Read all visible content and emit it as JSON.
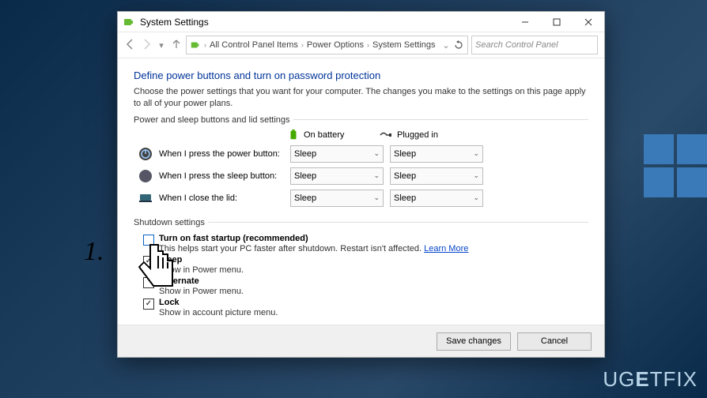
{
  "window": {
    "title": "System Settings",
    "breadcrumbs": [
      "All Control Panel Items",
      "Power Options",
      "System Settings"
    ],
    "search_placeholder": "Search Control Panel"
  },
  "page": {
    "heading": "Define power buttons and turn on password protection",
    "description": "Choose the power settings that you want for your computer. The changes you make to the settings on this page apply to all of your power plans.",
    "section_a": "Power and sleep buttons and lid settings",
    "col_battery": "On battery",
    "col_plugged": "Plugged in",
    "rows": [
      {
        "label": "When I press the power button:",
        "battery": "Sleep",
        "plugged": "Sleep"
      },
      {
        "label": "When I press the sleep button:",
        "battery": "Sleep",
        "plugged": "Sleep"
      },
      {
        "label": "When I close the lid:",
        "battery": "Sleep",
        "plugged": "Sleep"
      }
    ],
    "section_b": "Shutdown settings",
    "shutdown": [
      {
        "checked": false,
        "title": "Turn on fast startup (recommended)",
        "sub": "This helps start your PC faster after shutdown. Restart isn't affected.",
        "learn": "Learn More"
      },
      {
        "checked": true,
        "title": "Sleep",
        "sub": "Show in Power menu."
      },
      {
        "checked": false,
        "title": "Hibernate",
        "sub": "Show in Power menu."
      },
      {
        "checked": true,
        "title": "Lock",
        "sub": "Show in account picture menu."
      }
    ],
    "save": "Save changes",
    "cancel": "Cancel"
  },
  "annotation": "1.",
  "watermark": "UGETFIX"
}
